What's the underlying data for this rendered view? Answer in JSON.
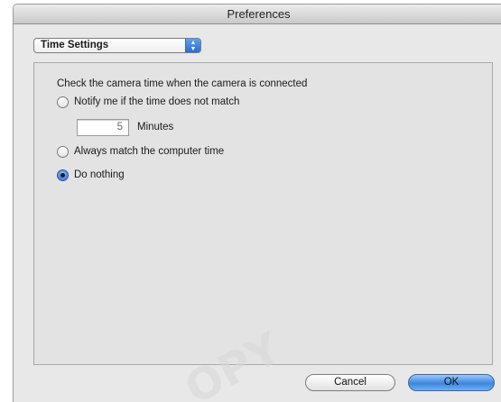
{
  "window": {
    "title": "Preferences"
  },
  "panel_select": {
    "selected": "Time Settings"
  },
  "time_settings": {
    "heading": "Check the camera time when the camera is connected",
    "options": [
      {
        "label": "Notify me if the time does not match",
        "selected": false
      },
      {
        "label": "Always match the computer time",
        "selected": false
      },
      {
        "label": "Do nothing",
        "selected": true
      }
    ],
    "minutes_value": "5",
    "minutes_label": "Minutes"
  },
  "buttons": {
    "cancel": "Cancel",
    "ok": "OK"
  },
  "watermark": {
    "text": "OPY"
  }
}
